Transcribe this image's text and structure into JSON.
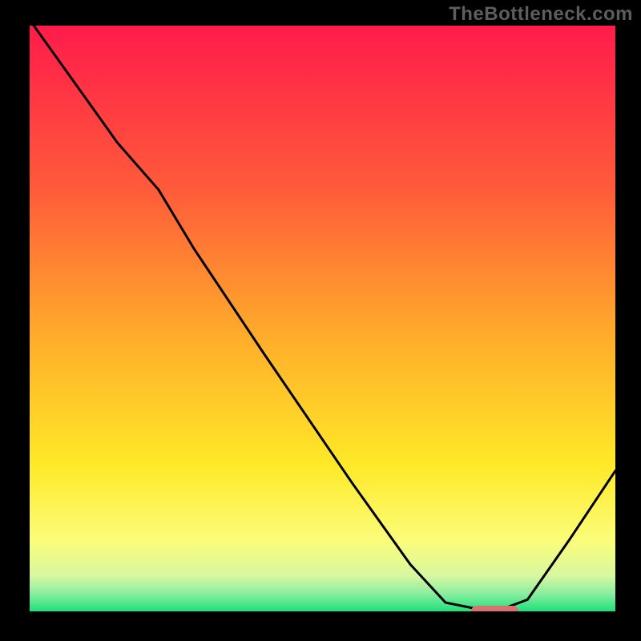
{
  "watermark": "TheBottleneck.com",
  "chart_data": {
    "type": "line",
    "title": "",
    "xlabel": "",
    "ylabel": "",
    "xlim": [
      0,
      100
    ],
    "ylim": [
      0,
      100
    ],
    "gradient_stops": [
      {
        "offset": 0,
        "color": "#ff1b4b"
      },
      {
        "offset": 28,
        "color": "#ff5b3a"
      },
      {
        "offset": 55,
        "color": "#ffb22a"
      },
      {
        "offset": 75,
        "color": "#ffe928"
      },
      {
        "offset": 88,
        "color": "#fbfd7a"
      },
      {
        "offset": 94,
        "color": "#d7f7a0"
      },
      {
        "offset": 97,
        "color": "#8aeea0"
      },
      {
        "offset": 100,
        "color": "#1ee07a"
      }
    ],
    "series": [
      {
        "name": "bottleneck-curve",
        "points": [
          {
            "x": 0,
            "y": 101
          },
          {
            "x": 5,
            "y": 94
          },
          {
            "x": 15,
            "y": 80
          },
          {
            "x": 22,
            "y": 72
          },
          {
            "x": 28,
            "y": 62
          },
          {
            "x": 40,
            "y": 44
          },
          {
            "x": 55,
            "y": 22
          },
          {
            "x": 65,
            "y": 8
          },
          {
            "x": 71,
            "y": 1.5
          },
          {
            "x": 76,
            "y": 0.5
          },
          {
            "x": 81,
            "y": 0.5
          },
          {
            "x": 85,
            "y": 2
          },
          {
            "x": 92,
            "y": 12
          },
          {
            "x": 100,
            "y": 24
          }
        ]
      }
    ],
    "marker": {
      "x_start": 75,
      "x_end": 83,
      "y": 0.5,
      "color": "#d97171"
    }
  }
}
